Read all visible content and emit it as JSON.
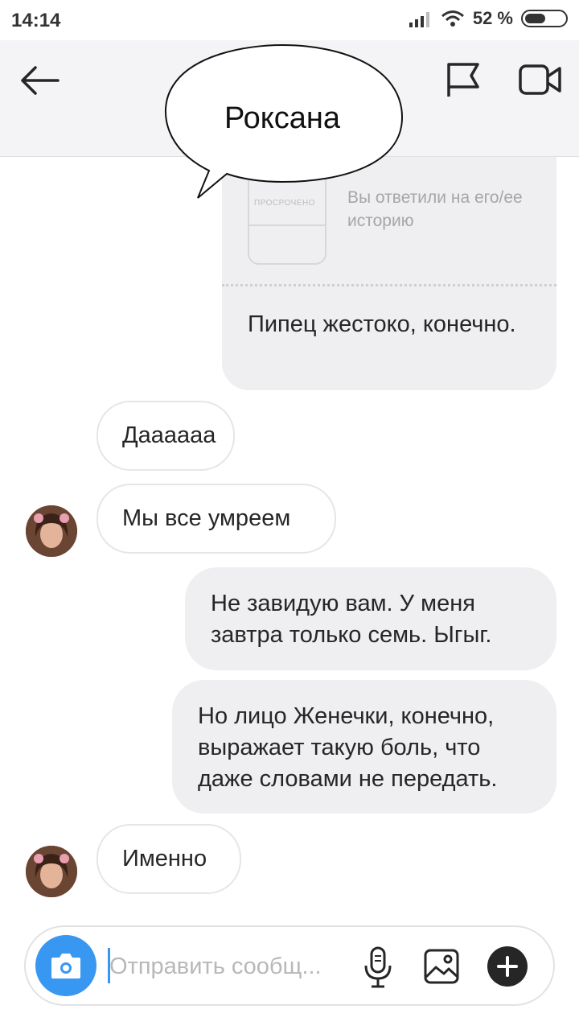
{
  "status_bar": {
    "time": "14:14",
    "battery_text": "52 %",
    "battery_level": 0.52
  },
  "header": {
    "contact_name": "Роксана",
    "icons": [
      "back-arrow-icon",
      "flag-icon",
      "video-call-icon"
    ]
  },
  "chat": {
    "story_reply": {
      "thumbnail_label": "ПРОСРОЧЕНО",
      "note": "Вы ответили на его/ее историю",
      "text": "Пипец жестоко, конечно."
    },
    "messages": [
      {
        "from": "contact",
        "text": "Даааааа"
      },
      {
        "from": "contact",
        "text": "Мы все умреем"
      },
      {
        "from": "me",
        "text": "Не завидую вам. У меня завтра только семь. Ыгыг."
      },
      {
        "from": "me",
        "text": "Но лицо Женечки, конечно, выражает такую боль, что даже словами не передать."
      },
      {
        "from": "contact",
        "text": "Именно"
      }
    ]
  },
  "composer": {
    "placeholder": "Отправить сообщ...",
    "icons": [
      "camera-icon",
      "microphone-icon",
      "gallery-icon",
      "plus-icon"
    ]
  },
  "colors": {
    "accent": "#3897f0",
    "bubble_out": "#efeff1",
    "bubble_in_border": "#e6e6e8",
    "header_bg": "#f4f4f6"
  }
}
